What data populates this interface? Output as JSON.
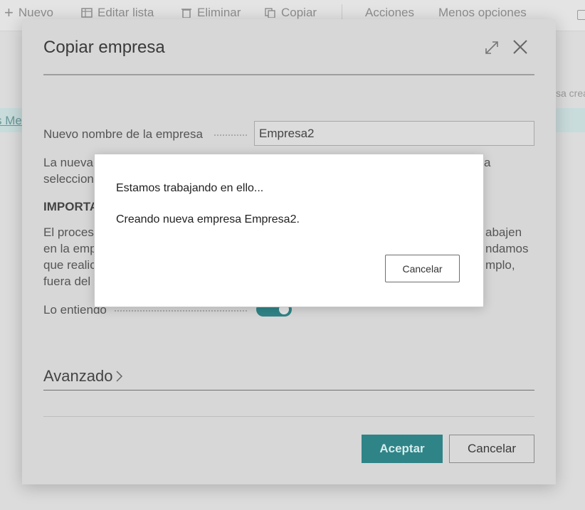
{
  "toolbar": {
    "new_label": "Nuevo",
    "edit_list_label": "Editar lista",
    "delete_label": "Eliminar",
    "copy_label": "Copiar",
    "actions_label": "Acciones",
    "fewer_options_label": "Menos opciones"
  },
  "background": {
    "left_link": "s Me",
    "right_text": "sa crea"
  },
  "dialog": {
    "title": "Copiar empresa",
    "new_name_label": "Nuevo nombre de la empresa",
    "new_name_value": "Empresa2",
    "para1_line1": "La nueva",
    "para1_line1_end": "a",
    "para1_line2": "seleccion",
    "important_label": "IMPORTA",
    "para2_line1": "El proces",
    "para2_line1_end": "abajen",
    "para2_line2": "en la emp",
    "para2_line2_end": "ndamos",
    "para2_line3": "que realic",
    "para2_line3_end": "mplo,",
    "para2_line4": "fuera del",
    "understand_label": "Lo entiendo",
    "understand_toggle_on": true,
    "advanced_label": "Avanzado",
    "ok_label": "Aceptar",
    "cancel_label": "Cancelar",
    "accent_color": "#2f8487"
  },
  "progress_dialog": {
    "line1": "Estamos trabajando en ello...",
    "line2": "Creando nueva empresa Empresa2.",
    "cancel_label": "Cancelar"
  }
}
